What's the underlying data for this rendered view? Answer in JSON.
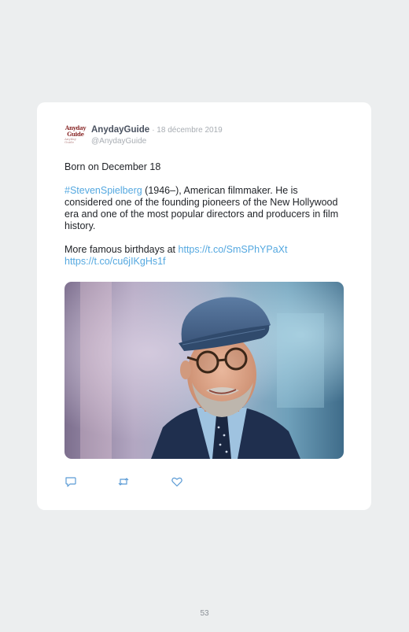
{
  "tweet": {
    "avatar": {
      "line1": "Anyday",
      "line2": "Guide",
      "line3": "Anyday Guide"
    },
    "author_name": "AnydayGuide",
    "date": "· 18 décembre 2019",
    "handle": "@AnydayGuide",
    "line_intro": "Born on December 18",
    "hashtag": "#StevenSpielberg",
    "bio_text": " (1946–), American filmmaker. He is considered one of the founding pioneers of the New Hollywood era and one of the most popular directors and producers in film history.",
    "more_text": "More famous birthdays at ",
    "link1": "https://t.co/SmSPhYPaXt",
    "link2": "https://t.co/cu6jIKgHs1f",
    "photo_description": "Portrait of a smiling man with glasses and a blue flat cap",
    "actions": [
      {
        "icon": "reply-icon"
      },
      {
        "icon": "retweet-icon"
      },
      {
        "icon": "like-icon"
      }
    ]
  },
  "page_number": "53",
  "colors": {
    "background": "#eceeef",
    "card": "#ffffff",
    "link": "#54a8e0",
    "name": "#4a5260",
    "meta": "#a8adb3",
    "icon": "#5b9bd5"
  }
}
